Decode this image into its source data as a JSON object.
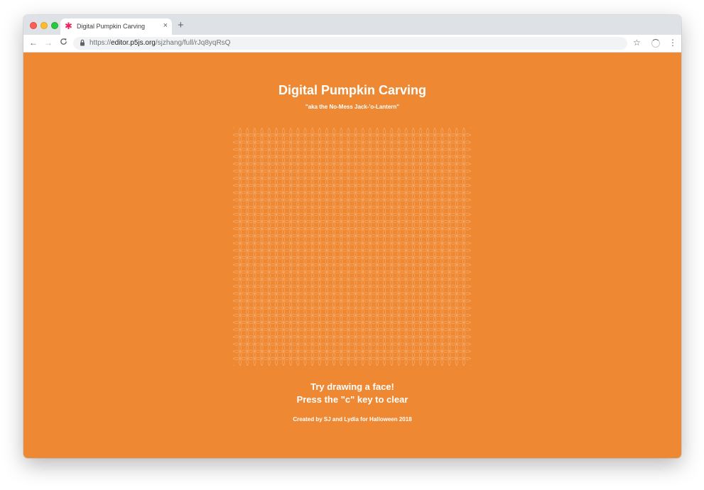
{
  "browser": {
    "tab": {
      "title": "Digital Pumpkin Carving",
      "favicon": "p5js-asterisk-icon",
      "close_label": "×"
    },
    "new_tab_label": "+",
    "toolbar": {
      "back_label": "←",
      "forward_label": "→",
      "reload_label": "C",
      "url_scheme": "https://",
      "url_host": "editor.p5js.org",
      "url_path": "/sjzhang/full/rJq8yqRsQ",
      "star_label": "☆",
      "menu_label": "⋮"
    }
  },
  "page": {
    "background": "#ee8833",
    "title": "Digital Pumpkin Carving",
    "subtitle": "\"aka the No-Mess Jack-'o-Lantern\"",
    "instruction_1": "Try drawing a face!",
    "instruction_2": "Press the \"c\" key to clear",
    "credits": "Created by SJ and Lydia for Halloween 2018"
  },
  "canvas": {
    "rows": 33,
    "cols": 33,
    "circle_color": "#f6aa6a",
    "fill_color": "#ee8833"
  }
}
